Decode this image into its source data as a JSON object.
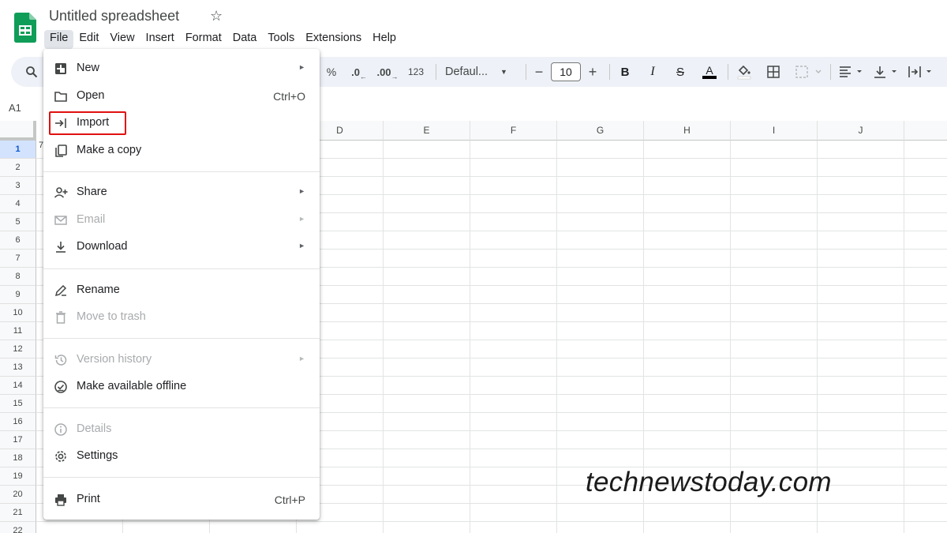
{
  "header": {
    "doc_title": "Untitled spreadsheet",
    "menu": [
      "File",
      "Edit",
      "View",
      "Insert",
      "Format",
      "Data",
      "Tools",
      "Extensions",
      "Help"
    ]
  },
  "toolbar": {
    "percent": "%",
    "dec_decrease": ".0",
    "dec_increase": ".00",
    "more_formats": "123",
    "font": "Defaul...",
    "minus": "−",
    "font_size": "10",
    "plus": "+",
    "bold": "B",
    "italic": "I",
    "strike": "S",
    "text_color": "A"
  },
  "name_box": "A1",
  "grid": {
    "columns": [
      "D",
      "E",
      "F",
      "G",
      "H",
      "I",
      "J"
    ],
    "rows": [
      "1",
      "2",
      "3",
      "4",
      "5",
      "6",
      "7",
      "8",
      "9",
      "10",
      "11",
      "12",
      "13",
      "14",
      "15",
      "16",
      "17",
      "18",
      "19",
      "20",
      "21",
      "22"
    ],
    "a1_partial": "7"
  },
  "file_menu": {
    "items": [
      {
        "label": "New",
        "icon": "new-icon",
        "submenu": true
      },
      {
        "label": "Open",
        "icon": "folder-icon",
        "shortcut": "Ctrl+O"
      },
      {
        "label": "Import",
        "icon": "import-icon"
      },
      {
        "label": "Make a copy",
        "icon": "copy-icon"
      },
      {
        "label": "Share",
        "icon": "share-icon",
        "submenu": true
      },
      {
        "label": "Email",
        "icon": "email-icon",
        "submenu": true,
        "disabled": true
      },
      {
        "label": "Download",
        "icon": "download-icon",
        "submenu": true
      },
      {
        "label": "Rename",
        "icon": "rename-icon"
      },
      {
        "label": "Move to trash",
        "icon": "trash-icon",
        "disabled": true
      },
      {
        "label": "Version history",
        "icon": "history-icon",
        "submenu": true,
        "disabled": true
      },
      {
        "label": "Make available offline",
        "icon": "offline-icon"
      },
      {
        "label": "Details",
        "icon": "info-icon",
        "disabled": true
      },
      {
        "label": "Settings",
        "icon": "gear-icon"
      },
      {
        "label": "Print",
        "icon": "print-icon",
        "shortcut": "Ctrl+P"
      }
    ]
  },
  "watermark": "technewstoday.com",
  "colors": {
    "sheets_green": "#0f9d58",
    "highlight_red": "#e01010",
    "toolbar_bg": "#eef2f8"
  }
}
